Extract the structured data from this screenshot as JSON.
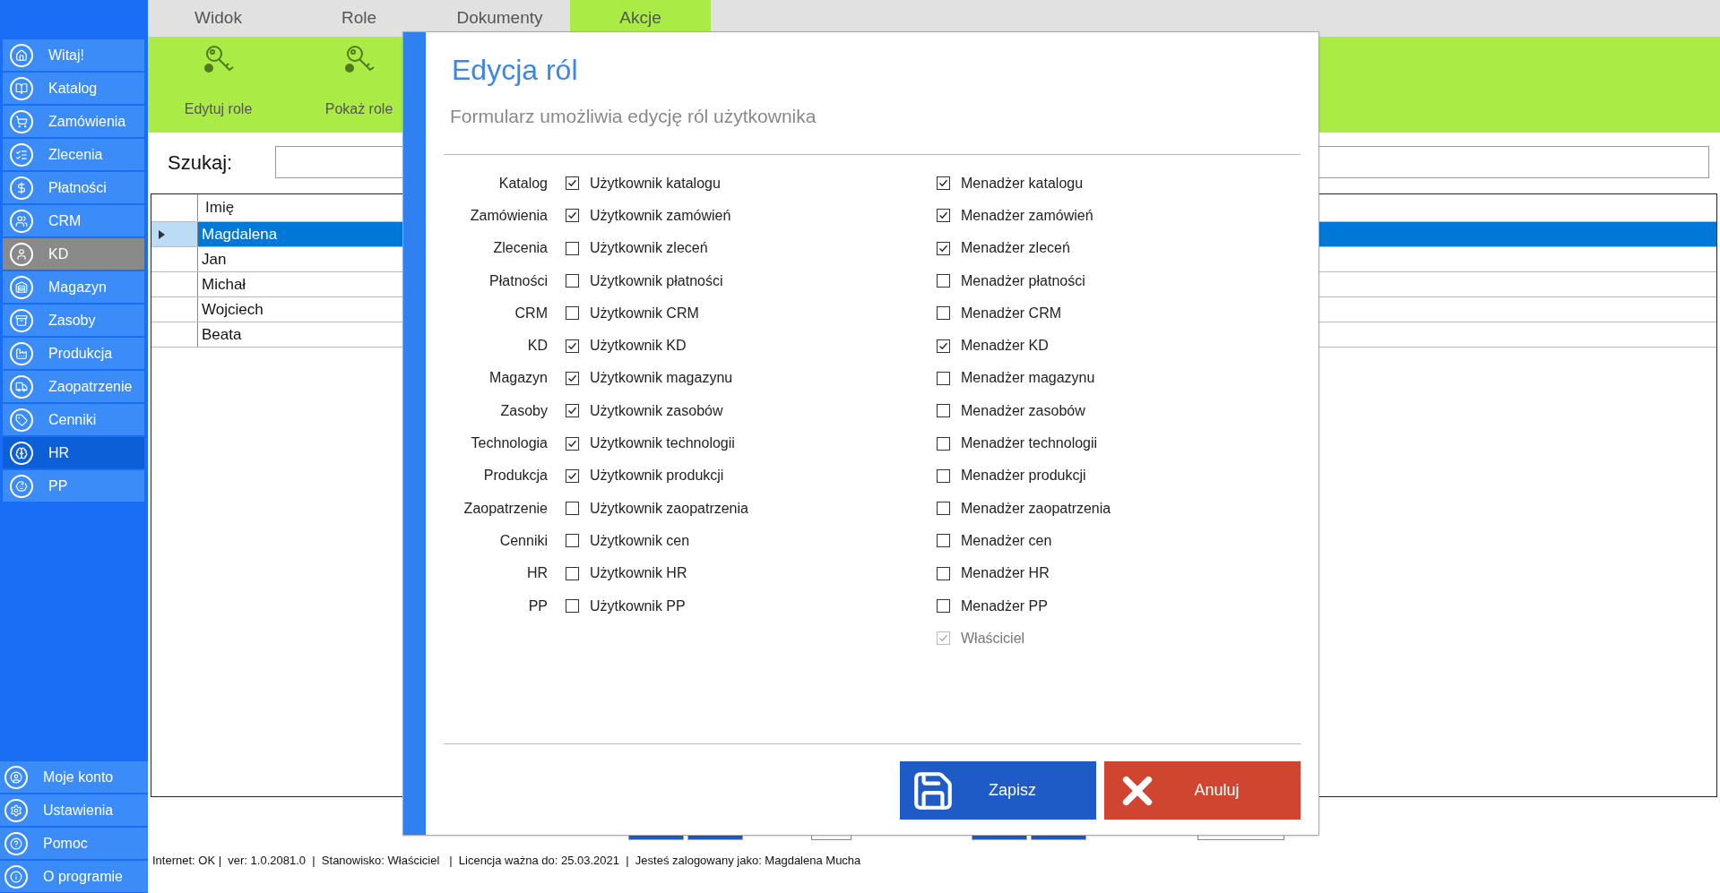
{
  "sidebar": {
    "items": [
      {
        "label": "Witaj!",
        "selected": false,
        "highlighted": false
      },
      {
        "label": "Katalog",
        "selected": false,
        "highlighted": false
      },
      {
        "label": "Zamówienia",
        "selected": false,
        "highlighted": false
      },
      {
        "label": "Zlecenia",
        "selected": false,
        "highlighted": false
      },
      {
        "label": "Płatności",
        "selected": false,
        "highlighted": false
      },
      {
        "label": "CRM",
        "selected": false,
        "highlighted": false
      },
      {
        "label": "KD",
        "selected": true,
        "highlighted": false
      },
      {
        "label": "Magazyn",
        "selected": false,
        "highlighted": false
      },
      {
        "label": "Zasoby",
        "selected": false,
        "highlighted": false
      },
      {
        "label": "Produkcja",
        "selected": false,
        "highlighted": false
      },
      {
        "label": "Zaopatrzenie",
        "selected": false,
        "highlighted": false
      },
      {
        "label": "Cenniki",
        "selected": false,
        "highlighted": false
      },
      {
        "label": "HR",
        "selected": false,
        "highlighted": true
      },
      {
        "label": "PP",
        "selected": false,
        "highlighted": false
      }
    ],
    "bottom_items": [
      {
        "label": "Moje konto"
      },
      {
        "label": "Ustawienia"
      },
      {
        "label": "Pomoc"
      },
      {
        "label": "O programie"
      }
    ]
  },
  "tabs": [
    {
      "label": "Widok",
      "selected": false
    },
    {
      "label": "Role",
      "selected": false
    },
    {
      "label": "Dokumenty",
      "selected": false
    },
    {
      "label": "Akcje",
      "selected": true
    }
  ],
  "toolbar": [
    {
      "label": "Edytuj role"
    },
    {
      "label": "Pokaż role"
    }
  ],
  "search": {
    "label": "Szukaj:"
  },
  "table": {
    "columns": [
      "Imię"
    ],
    "rows": [
      {
        "name": "Magdalena",
        "selected": true
      },
      {
        "name": "Jan",
        "selected": false
      },
      {
        "name": "Michał",
        "selected": false
      },
      {
        "name": "Wojciech",
        "selected": false
      },
      {
        "name": "Beata",
        "selected": false
      }
    ]
  },
  "dialog": {
    "title": "Edycja ról",
    "subtitle": "Formularz umożliwia edycję ról użytkownika",
    "roles": [
      {
        "module": "Katalog",
        "user": {
          "label": "Użytkownik katalogu",
          "checked": true
        },
        "manager": {
          "label": "Menadżer katalogu",
          "checked": true
        }
      },
      {
        "module": "Zamówienia",
        "user": {
          "label": "Użytkownik zamówień",
          "checked": true
        },
        "manager": {
          "label": "Menadżer zamówień",
          "checked": true
        }
      },
      {
        "module": "Zlecenia",
        "user": {
          "label": "Użytkownik zleceń",
          "checked": false
        },
        "manager": {
          "label": "Menadżer zleceń",
          "checked": true
        }
      },
      {
        "module": "Płatności",
        "user": {
          "label": "Użytkownik płatności",
          "checked": false
        },
        "manager": {
          "label": "Menadżer płatności",
          "checked": false
        }
      },
      {
        "module": "CRM",
        "user": {
          "label": "Użytkownik CRM",
          "checked": false
        },
        "manager": {
          "label": "Menadżer CRM",
          "checked": false
        }
      },
      {
        "module": "KD",
        "user": {
          "label": "Użytkownik KD",
          "checked": true
        },
        "manager": {
          "label": "Menadżer KD",
          "checked": true
        }
      },
      {
        "module": "Magazyn",
        "user": {
          "label": "Użytkownik magazynu",
          "checked": true
        },
        "manager": {
          "label": "Menadżer magazynu",
          "checked": false
        }
      },
      {
        "module": "Zasoby",
        "user": {
          "label": "Użytkownik zasobów",
          "checked": true
        },
        "manager": {
          "label": "Menadżer zasobów",
          "checked": false
        }
      },
      {
        "module": "Technologia",
        "user": {
          "label": "Użytkownik technologii",
          "checked": true
        },
        "manager": {
          "label": "Menadżer technologii",
          "checked": false
        }
      },
      {
        "module": "Produkcja",
        "user": {
          "label": "Użytkownik produkcji",
          "checked": true
        },
        "manager": {
          "label": "Menadżer produkcji",
          "checked": false
        }
      },
      {
        "module": "Zaopatrzenie",
        "user": {
          "label": "Użytkownik zaopatrzenia",
          "checked": false
        },
        "manager": {
          "label": "Menadżer zaopatrzenia",
          "checked": false
        }
      },
      {
        "module": "Cenniki",
        "user": {
          "label": "Użytkownik cen",
          "checked": false
        },
        "manager": {
          "label": "Menadżer cen",
          "checked": false
        }
      },
      {
        "module": "HR",
        "user": {
          "label": "Użytkownik HR",
          "checked": false
        },
        "manager": {
          "label": "Menadżer HR",
          "checked": false
        }
      },
      {
        "module": "PP",
        "user": {
          "label": "Użytkownik PP",
          "checked": false
        },
        "manager": {
          "label": "Menadżer PP",
          "checked": false
        }
      }
    ],
    "owner": {
      "label": "Właściciel",
      "checked": true,
      "disabled": true
    },
    "buttons": [
      {
        "label": "Zapisz",
        "kind": "save"
      },
      {
        "label": "Anuluj",
        "kind": "cancel"
      }
    ]
  },
  "status_bar": "Internet: OK |  ver: 1.0.2081.0  |  Stanowisko: Właściciel   |  Licencja ważna do: 25.03.2021  |  Jesteś zalogowany jako: Magdalena Mucha"
}
